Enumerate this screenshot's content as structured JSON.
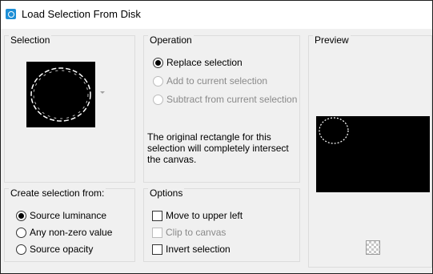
{
  "window": {
    "title": "Load Selection From Disk"
  },
  "selection": {
    "label": "Selection"
  },
  "operation": {
    "label": "Operation",
    "options": [
      {
        "label": "Replace selection",
        "checked": true,
        "enabled": true
      },
      {
        "label": "Add to current selection",
        "checked": false,
        "enabled": false
      },
      {
        "label": "Subtract from current selection",
        "checked": false,
        "enabled": false
      }
    ],
    "info": "The original rectangle for this selection will completely intersect the canvas."
  },
  "preview": {
    "label": "Preview"
  },
  "create_from": {
    "label": "Create selection from:",
    "options": [
      {
        "label": "Source luminance",
        "checked": true
      },
      {
        "label": "Any non-zero value",
        "checked": false
      },
      {
        "label": "Source opacity",
        "checked": false
      }
    ]
  },
  "options": {
    "label": "Options",
    "items": [
      {
        "label": "Move to upper left",
        "checked": false,
        "enabled": true
      },
      {
        "label": "Clip to canvas",
        "checked": false,
        "enabled": false
      },
      {
        "label": "Invert selection",
        "checked": false,
        "enabled": true
      }
    ]
  },
  "colors": {
    "accent": "#1e8fd6",
    "background": "#f0f0f0",
    "canvas": "#000000"
  }
}
